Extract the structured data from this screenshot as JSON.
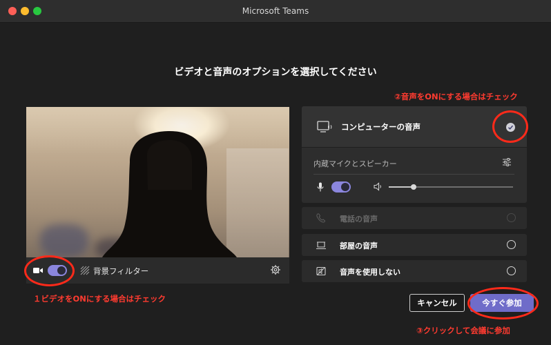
{
  "window": {
    "title": "Microsoft Teams"
  },
  "heading": "ビデオと音声のオプションを選択してください",
  "annotations": {
    "audio_note": "②音声をONにする場合はチェック",
    "video_note": "１ビデオをONにする場合はチェック",
    "join_note": "③クリックして会議に参加"
  },
  "video": {
    "background_filter_label": "背景フィルター",
    "camera_on": true
  },
  "audio": {
    "computer_audio_label": "コンピューターの音声",
    "computer_audio_selected": true,
    "device_label": "内蔵マイクとスピーカー",
    "mic_on": true,
    "speaker_volume": 0.2,
    "options": [
      {
        "label": "電話の音声",
        "enabled": false
      },
      {
        "label": "部屋の音声",
        "enabled": true
      },
      {
        "label": "音声を使用しない",
        "enabled": true
      }
    ]
  },
  "buttons": {
    "cancel": "キャンセル",
    "join_now": "今すぐ参加"
  },
  "colors": {
    "accent": "#6f6cc9",
    "toggle_on": "#8b86dd",
    "annotation": "#ff2a1a"
  }
}
